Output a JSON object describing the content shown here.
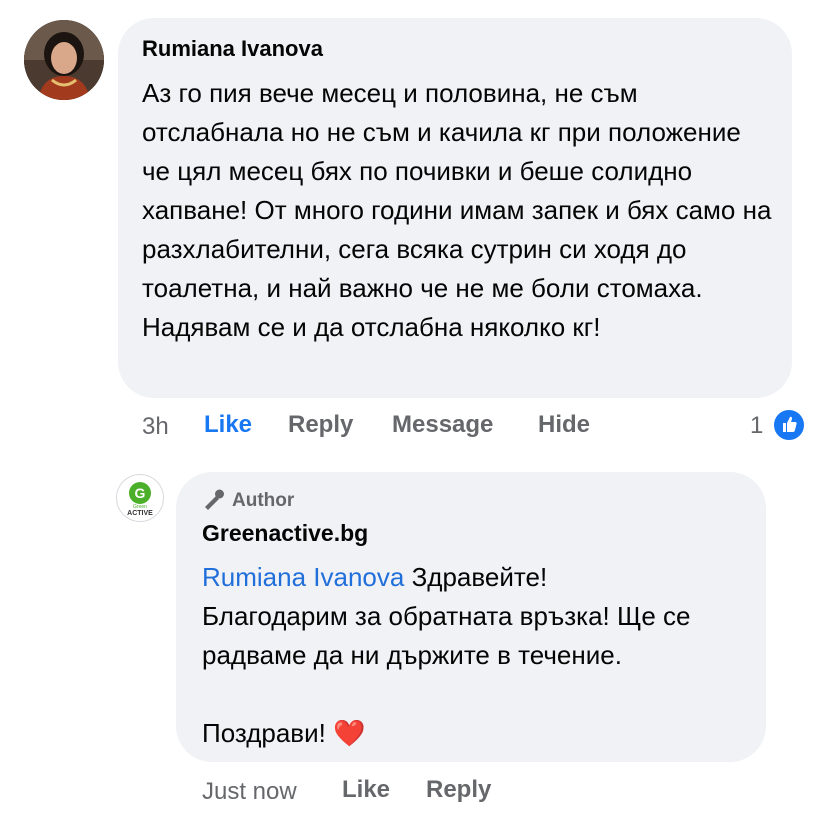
{
  "comment": {
    "author": "Rumiana Ivanova",
    "text": "Аз го пия вече месец и половина, не съм отслабнала но не съм и качила кг при положение че цял месец бях по почивки и беше солидно хапване! От много години имам запек и бях само на разхлабителни, сега всяка сутрин си ходя до тоалетна, и най важно че не ме боли стомаха. Надявам се и да отслабна няколко кг!",
    "time": "3h",
    "actions": {
      "like": "Like",
      "reply": "Reply",
      "message": "Message",
      "hide": "Hide"
    },
    "reaction_count": "1",
    "reaction_icon": "thumbs-up-icon"
  },
  "reply": {
    "badge": "Author",
    "author": "Greenactive.bg",
    "mention": "Rumiana Ivanova",
    "text_line1": "Здравейте!",
    "text_body": "Благодарим за обратната връзка! Ще се радваме да ни държите в течение.",
    "closing": "Поздрави!",
    "heart": "❤️",
    "time": "Just now",
    "actions": {
      "like": "Like",
      "reply": "Reply"
    },
    "avatar_logo_text": "G",
    "avatar_logo_brand_small": "Green",
    "avatar_logo_brand_large": "ACTIVE"
  },
  "colors": {
    "bubble": "#f0f2f5",
    "link": "#1877f2",
    "mention": "#216fdb",
    "muted": "#65676b",
    "heart": "#e41e3f",
    "brand_green": "#4caf2a"
  }
}
